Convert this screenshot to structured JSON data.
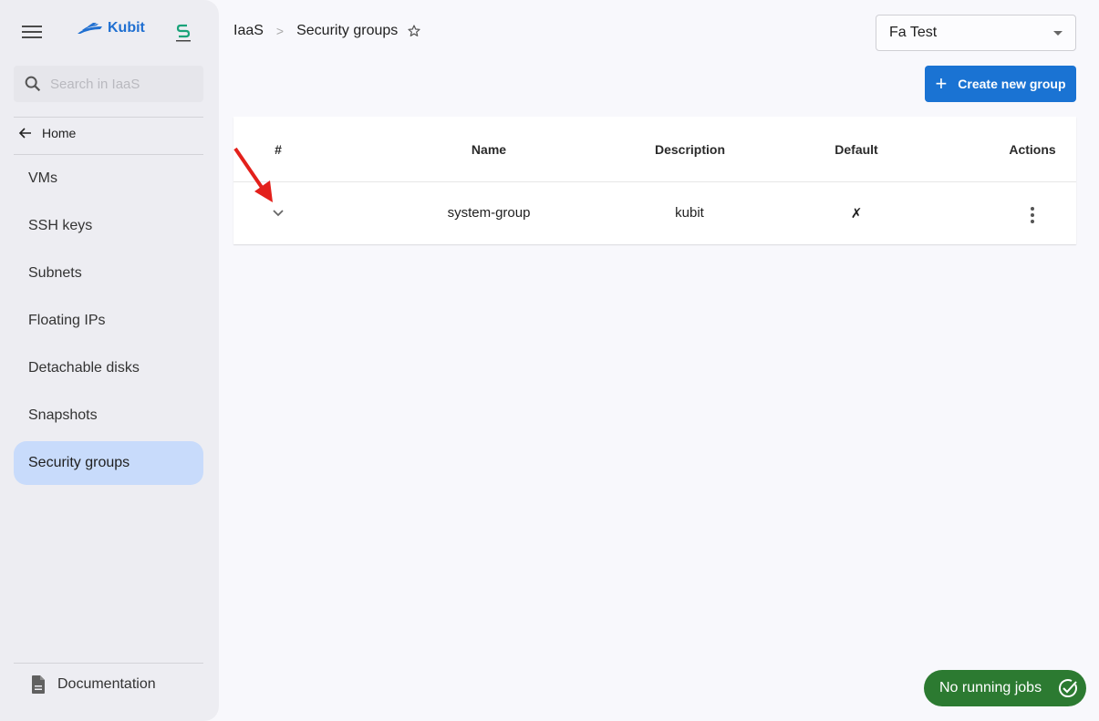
{
  "sidebar": {
    "brand": "Kubit",
    "search": {
      "placeholder": "Search in IaaS",
      "value": ""
    },
    "home_label": "Home",
    "items": [
      {
        "label": "VMs",
        "active": false
      },
      {
        "label": "SSH keys",
        "active": false
      },
      {
        "label": "Subnets",
        "active": false
      },
      {
        "label": "Floating IPs",
        "active": false
      },
      {
        "label": "Detachable disks",
        "active": false
      },
      {
        "label": "Snapshots",
        "active": false
      },
      {
        "label": "Security groups",
        "active": true
      }
    ],
    "documentation_label": "Documentation"
  },
  "header": {
    "breadcrumb": [
      "IaaS",
      "Security groups"
    ],
    "breadcrumb_separator": ">",
    "project_select": {
      "selected": "Fa Test"
    },
    "create_button_label": "Create new group"
  },
  "table": {
    "columns": [
      "#",
      "Name",
      "Description",
      "Default",
      "Actions"
    ],
    "rows": [
      {
        "name": "system-group",
        "description": "kubit",
        "default": "✗"
      }
    ]
  },
  "status": {
    "jobs_label": "No running jobs"
  },
  "colors": {
    "brand": "#1f6fd1",
    "primary_button": "#1a73d3",
    "active_nav": "#c8dbfb",
    "jobs_pill": "#2c7a31",
    "annotation_arrow": "#e3201b"
  }
}
